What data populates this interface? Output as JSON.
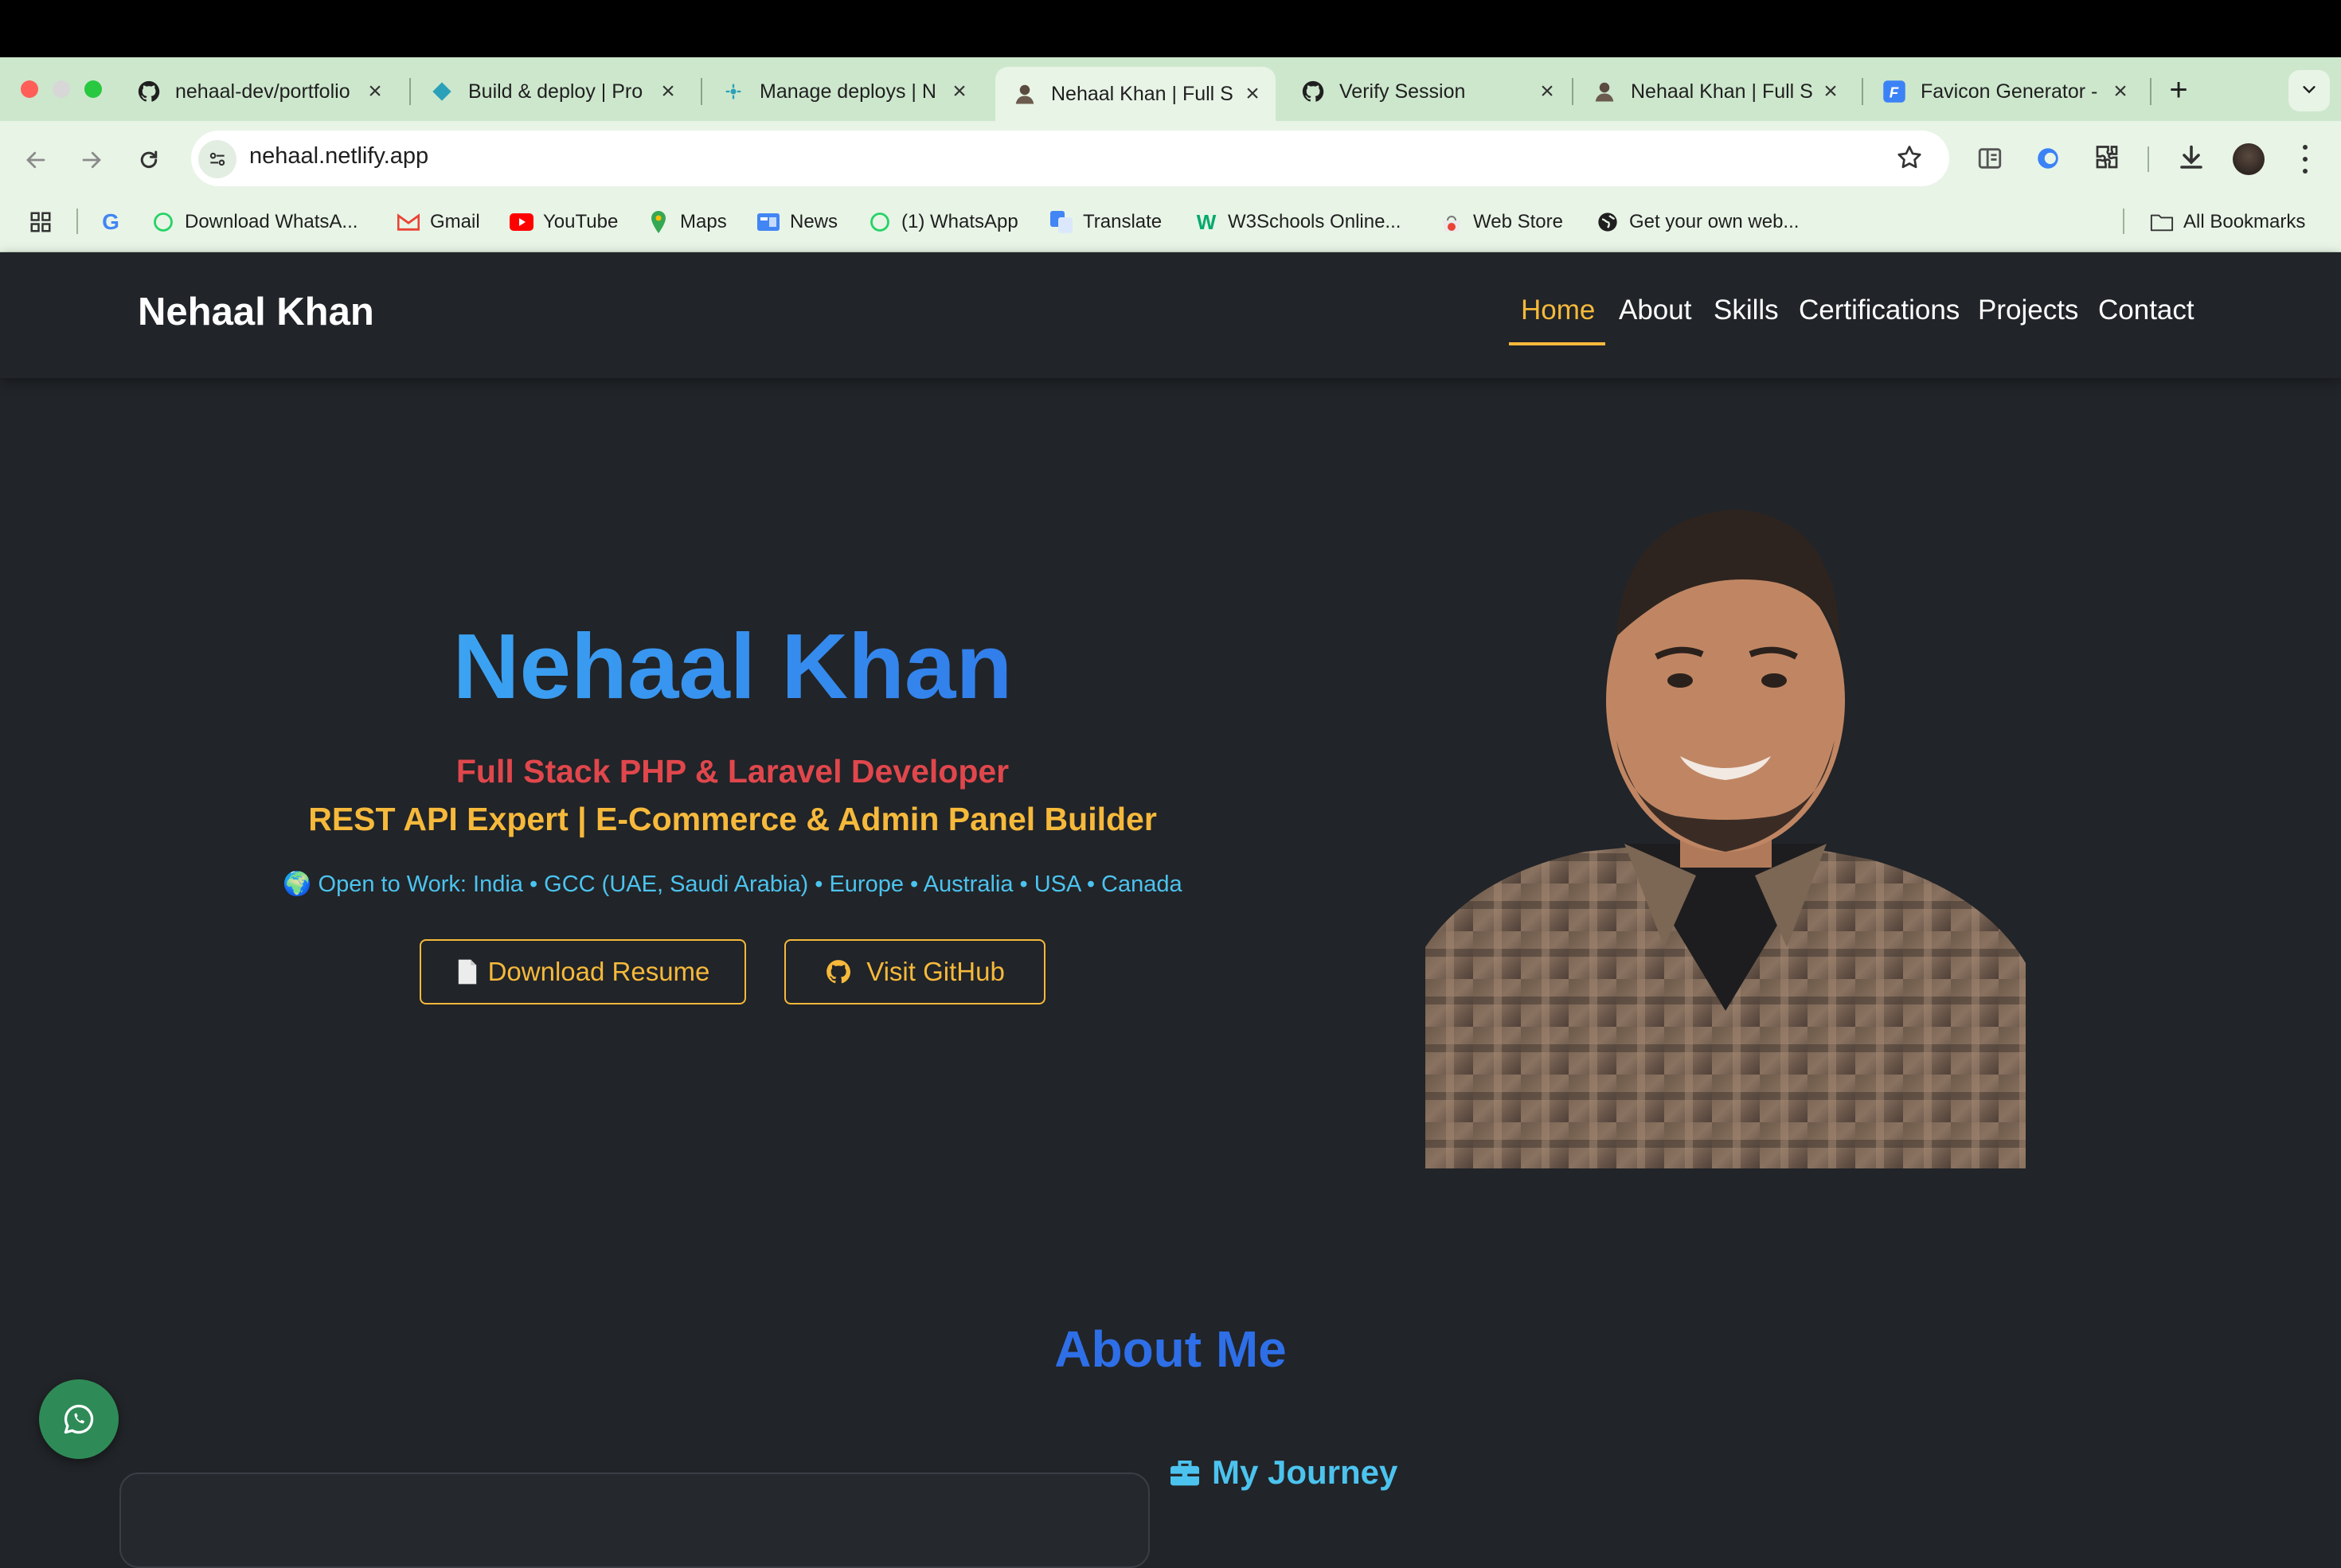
{
  "browser": {
    "tabs": [
      {
        "title": "nehaal-dev/portfolio",
        "icon": "github-icon"
      },
      {
        "title": "Build & deploy | Pro",
        "icon": "netlify-diamond-icon"
      },
      {
        "title": "Manage deploys | N",
        "icon": "netlify-icon"
      },
      {
        "title": "Nehaal Khan | Full S",
        "icon": "avatar-icon",
        "active": true
      },
      {
        "title": "Verify Session",
        "icon": "github-icon"
      },
      {
        "title": "Nehaal Khan | Full S",
        "icon": "avatar-icon"
      },
      {
        "title": "Favicon Generator -",
        "icon": "favicon-generator-icon"
      }
    ],
    "new_tab": "+",
    "url": "nehaal.netlify.app",
    "bookmarks": [
      {
        "label": "",
        "icon": "google-icon"
      },
      {
        "label": "Download WhatsA...",
        "icon": "whatsapp-icon"
      },
      {
        "label": "Gmail",
        "icon": "gmail-icon"
      },
      {
        "label": "YouTube",
        "icon": "youtube-icon"
      },
      {
        "label": "Maps",
        "icon": "maps-icon"
      },
      {
        "label": "News",
        "icon": "news-icon"
      },
      {
        "label": "(1) WhatsApp",
        "icon": "whatsapp-icon"
      },
      {
        "label": "Translate",
        "icon": "translate-icon"
      },
      {
        "label": "W3Schools Online...",
        "icon": "w3schools-icon"
      },
      {
        "label": "Web Store",
        "icon": "webstore-icon"
      },
      {
        "label": "Get your own web...",
        "icon": "globe-icon"
      }
    ],
    "all_bookmarks": "All Bookmarks"
  },
  "site": {
    "brand": "Nehaal Khan",
    "nav": [
      "Home",
      "About",
      "Skills",
      "Certifications",
      "Projects",
      "Contact"
    ],
    "active_nav": "Home"
  },
  "hero": {
    "name": "Nehaal Khan",
    "role": "Full Stack PHP & Laravel Developer",
    "subtitle": "REST API Expert | E-Commerce & Admin Panel Builder",
    "open_to_work": "🌍 Open to Work: India • GCC (UAE, Saudi Arabia) • Europe • Australia • USA • Canada",
    "resume_button": "Download Resume",
    "github_button": "Visit GitHub"
  },
  "about": {
    "title": "About Me",
    "journey_title": "My Journey"
  },
  "colors": {
    "background": "#212428",
    "accent_yellow": "#f6b93b",
    "accent_blue": "#2e6fe8",
    "accent_cyan": "#4cc3ef",
    "accent_red": "#e0474c",
    "browser_chrome": "#e8f4e6"
  }
}
